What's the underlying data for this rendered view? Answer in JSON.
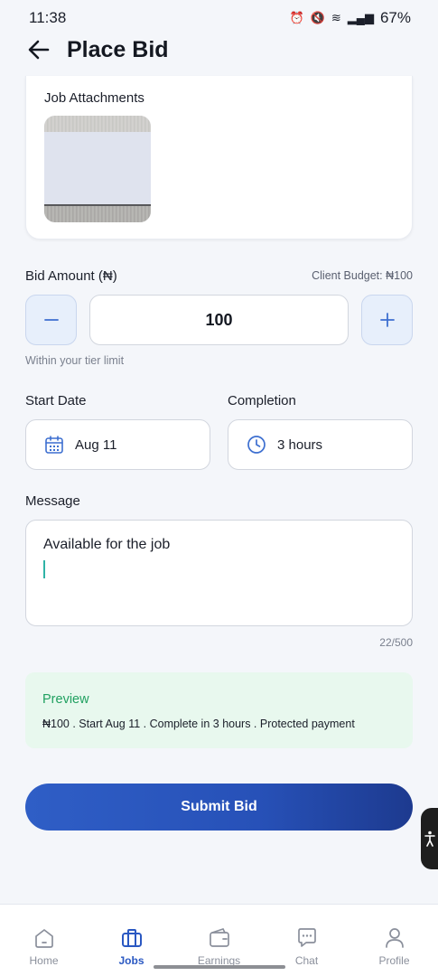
{
  "status": {
    "time": "11:38",
    "battery": "67%"
  },
  "header": {
    "title": "Place Bid"
  },
  "attachments": {
    "label": "Job Attachments"
  },
  "bid": {
    "label": "Bid Amount (₦)",
    "client_budget": "Client Budget: ₦100",
    "value": "100",
    "hint": "Within your tier limit"
  },
  "start_date": {
    "label": "Start Date",
    "value": "Aug 11"
  },
  "completion": {
    "label": "Completion",
    "value": "3 hours"
  },
  "message": {
    "label": "Message",
    "value": "Available for the job",
    "counter": "22/500"
  },
  "preview": {
    "title": "Preview",
    "text": "₦100 . Start Aug 11 . Complete in 3 hours . Protected payment"
  },
  "submit": {
    "label": "Submit Bid"
  },
  "nav": {
    "items": [
      {
        "label": "Home",
        "icon": "home-icon"
      },
      {
        "label": "Jobs",
        "icon": "briefcase-icon",
        "active": true
      },
      {
        "label": "Earnings",
        "icon": "wallet-icon"
      },
      {
        "label": "Chat",
        "icon": "chat-icon"
      },
      {
        "label": "Profile",
        "icon": "profile-icon"
      }
    ]
  },
  "colors": {
    "accent": "#2a58c2",
    "preview_green": "#20a060",
    "preview_bg": "#e8f8ee"
  }
}
